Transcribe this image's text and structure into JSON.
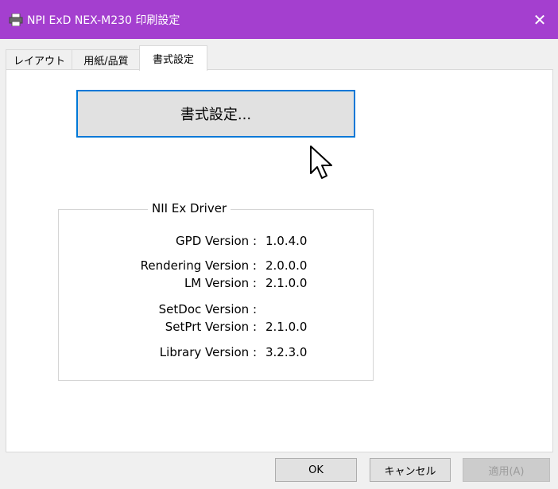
{
  "window": {
    "title": "NPI ExD NEX-M230 印刷設定",
    "title_bar_color": "#a43fcf"
  },
  "tabs": [
    {
      "label": "レイアウト",
      "active": false
    },
    {
      "label": "用紙/品質",
      "active": false
    },
    {
      "label": "書式設定",
      "active": true
    }
  ],
  "panel": {
    "format_button_label": "書式設定...",
    "driver_group": {
      "title": "NII Ex Driver",
      "versions": [
        {
          "label": "GPD Version :",
          "value": "1.0.4.0"
        },
        {
          "label": "Rendering Version :",
          "value": "2.0.0.0"
        },
        {
          "label": "LM Version :",
          "value": "2.1.0.0"
        },
        {
          "label": "SetDoc Version :",
          "value": ""
        },
        {
          "label": "SetPrt Version :",
          "value": "2.1.0.0"
        },
        {
          "label": "Library Version :",
          "value": "3.2.3.0"
        }
      ]
    }
  },
  "footer": {
    "ok_label": "OK",
    "cancel_label": "キャンセル",
    "apply_label": "適用(A)"
  }
}
